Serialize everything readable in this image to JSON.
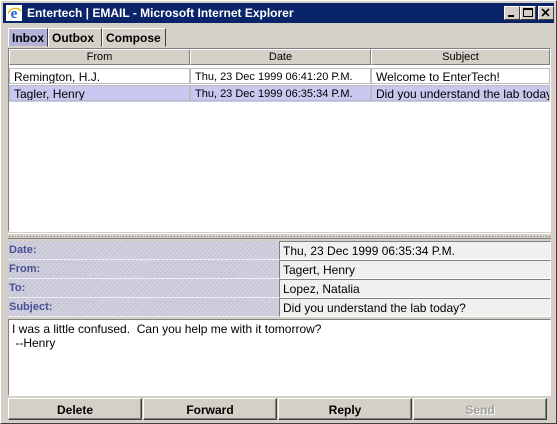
{
  "window": {
    "title": "Entertech | EMAIL - Microsoft Internet Explorer"
  },
  "tabs": [
    {
      "label": "Inbox",
      "active": true
    },
    {
      "label": "Outbox",
      "active": false
    },
    {
      "label": "Compose",
      "active": false
    }
  ],
  "list": {
    "columns": [
      "From",
      "Date",
      "Subject"
    ],
    "rows": [
      {
        "from": "Remington, H.J.",
        "date": "Thu, 23 Dec 1999 06:41:20 P.M.",
        "subject": "Welcome to EnterTech!",
        "selected": false
      },
      {
        "from": "Tagler, Henry",
        "date": "Thu, 23 Dec 1999 06:35:34 P.M.",
        "subject": "Did you understand the lab today?",
        "selected": true
      }
    ]
  },
  "detail": {
    "date_label": "Date:",
    "date_value": "Thu, 23 Dec 1999 06:35:34 P.M.",
    "from_label": "From:",
    "from_value": "Tagert, Henry",
    "to_label": "To:",
    "to_value": "Lopez, Natalia",
    "subject_label": "Subject:",
    "subject_value": "Did you understand the lab today?"
  },
  "message": {
    "lines": [
      "I was a little confused.  Can you help me with it tomorrow?",
      " --Henry"
    ]
  },
  "buttons": {
    "delete": "Delete",
    "forward": "Forward",
    "reply": "Reply",
    "send": "Send",
    "send_enabled": false
  },
  "colors": {
    "titlebar": "#0a246a",
    "selected_row": "#c8c8f0",
    "label_text": "#4a5094"
  }
}
